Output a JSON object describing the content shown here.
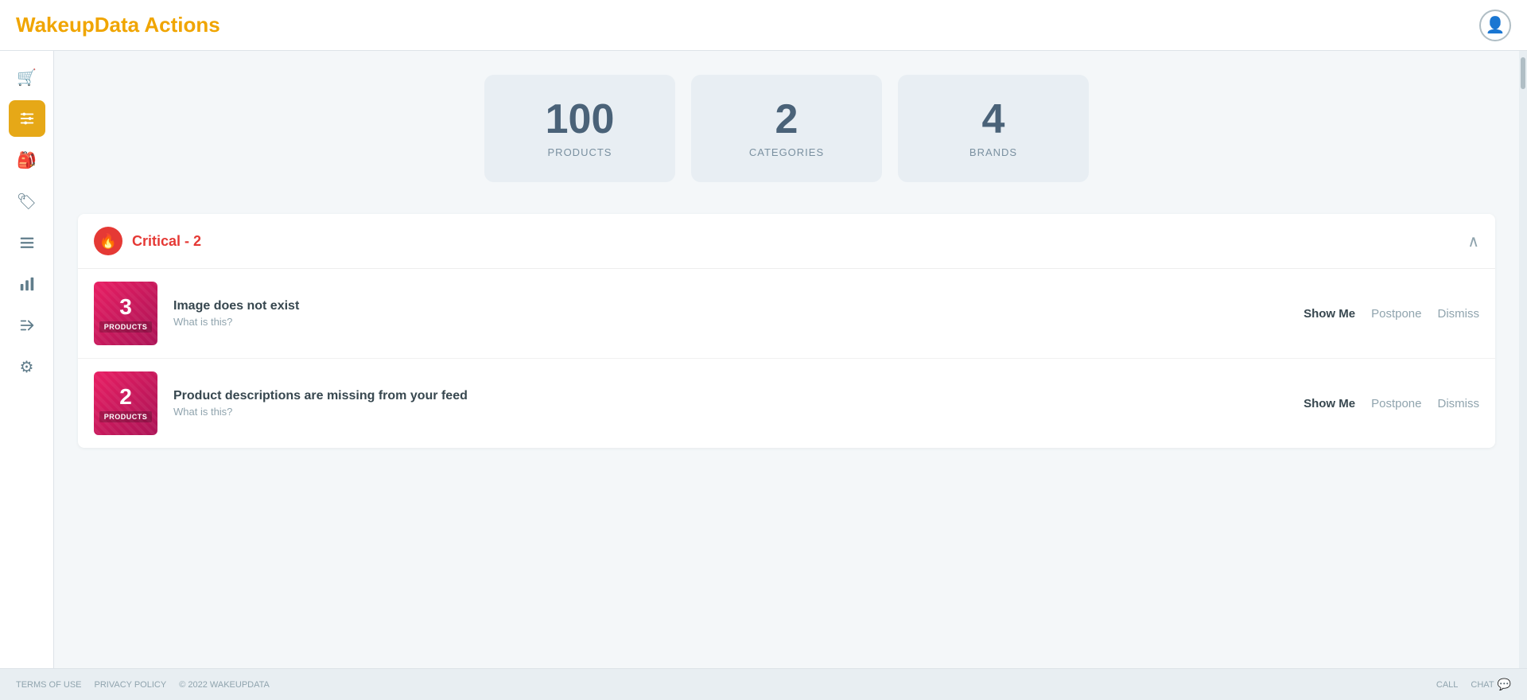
{
  "header": {
    "title_prefix": "WakeupData",
    "title_suffix": "Actions",
    "avatar_icon": "👤"
  },
  "sidebar": {
    "items": [
      {
        "id": "cart",
        "icon": "🛒",
        "active": false,
        "label": "Cart"
      },
      {
        "id": "filters",
        "icon": "🎚",
        "active": true,
        "label": "Filters"
      },
      {
        "id": "feed",
        "icon": "🎒",
        "active": false,
        "label": "Feed"
      },
      {
        "id": "tags",
        "icon": "🏷",
        "active": false,
        "label": "Tags"
      },
      {
        "id": "list",
        "icon": "☰",
        "active": false,
        "label": "List"
      },
      {
        "id": "chart",
        "icon": "📊",
        "active": false,
        "label": "Chart"
      },
      {
        "id": "export",
        "icon": "➡",
        "active": false,
        "label": "Export"
      },
      {
        "id": "settings",
        "icon": "⚙",
        "active": false,
        "label": "Settings"
      }
    ]
  },
  "stats": [
    {
      "number": "100",
      "label": "PRODUCTS"
    },
    {
      "number": "2",
      "label": "CATEGORIES"
    },
    {
      "number": "4",
      "label": "BRANDS"
    }
  ],
  "critical_section": {
    "title": "Critical - ",
    "count": "2",
    "icon": "🔥",
    "chevron": "∧",
    "items": [
      {
        "badge_number": "3",
        "badge_label": "PRODUCTS",
        "title": "Image does not exist",
        "subtitle": "What is this?",
        "btn_show": "Show Me",
        "btn_postpone": "Postpone",
        "btn_dismiss": "Dismiss"
      },
      {
        "badge_number": "2",
        "badge_label": "PRODUCTS",
        "title": "Product descriptions are missing from your feed",
        "subtitle": "What is this?",
        "btn_show": "Show Me",
        "btn_postpone": "Postpone",
        "btn_dismiss": "Dismiss"
      }
    ]
  },
  "footer": {
    "terms": "TERMS OF USE",
    "privacy": "PRIVACY POLICY",
    "copyright": "© 2022 WAKEUPDATA",
    "call": "CALL",
    "chat": "CHAT"
  }
}
